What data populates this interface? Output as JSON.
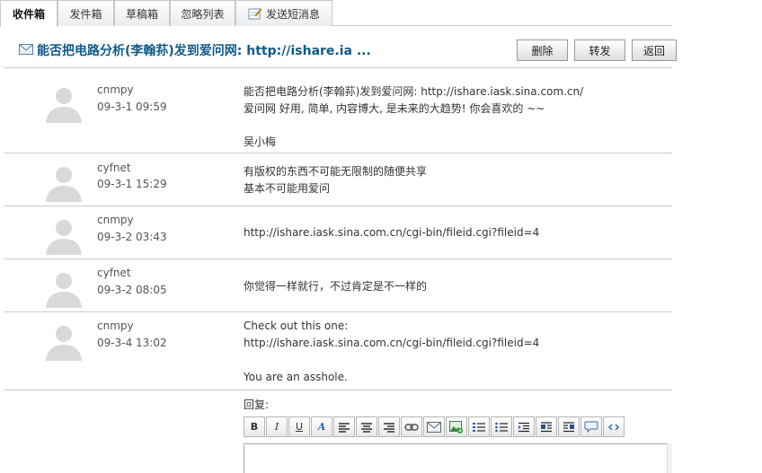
{
  "tabs": [
    {
      "label": "收件箱",
      "active": true
    },
    {
      "label": "发件箱",
      "active": false
    },
    {
      "label": "草稿箱",
      "active": false
    },
    {
      "label": "忽略列表",
      "active": false
    },
    {
      "label": "发送短消息",
      "active": false,
      "icon": "compose-icon"
    }
  ],
  "title": "能否把电路分析(李翰荪)发到爱问网: http://ishare.ia ...",
  "actions": {
    "delete": "删除",
    "forward": "转发",
    "back": "返回"
  },
  "messages": [
    {
      "sender": "cnmpy",
      "time": "09-3-1 09:59",
      "lines": [
        "能否把电路分析(李翰荪)发到爱问网: http://ishare.iask.sina.com.cn/",
        "爱问网 好用, 简单, 内容博大, 是未来的大趋势! 你会喜欢的 ~~",
        "",
        "吴小梅"
      ]
    },
    {
      "sender": "cyfnet",
      "time": "09-3-1 15:29",
      "lines": [
        "有版权的东西不可能无限制的随便共享",
        "基本不可能用爱问"
      ]
    },
    {
      "sender": "cnmpy",
      "time": "09-3-2 03:43",
      "lines": [
        "http://ishare.iask.sina.com.cn/cgi-bin/fileid.cgi?fileid=4"
      ]
    },
    {
      "sender": "cyfnet",
      "time": "09-3-2 08:05",
      "lines": [
        "你觉得一样就行，不过肯定是不一样的"
      ]
    },
    {
      "sender": "cnmpy",
      "time": "09-3-4 13:02",
      "lines": [
        "Check out this one:",
        "http://ishare.iask.sina.com.cn/cgi-bin/fileid.cgi?fileid=4",
        "",
        "You are an asshole."
      ]
    }
  ],
  "reply": {
    "label": "回复:",
    "toolbar": [
      "B",
      "I",
      "U",
      "A"
    ]
  },
  "colors": {
    "title": "#0f5a8a",
    "border": "#c9c9c9"
  }
}
